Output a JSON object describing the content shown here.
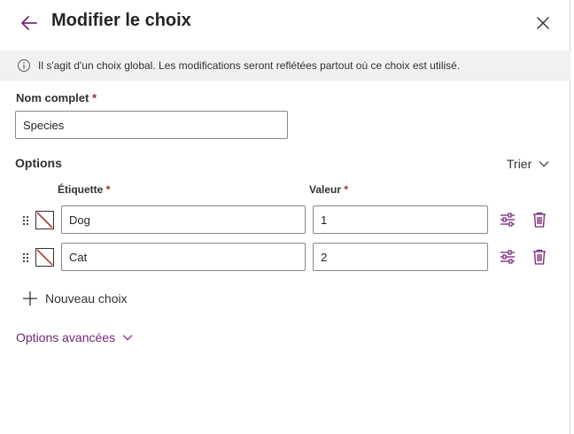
{
  "panel": {
    "title": "Modifier le choix"
  },
  "info": {
    "message": "Il s'agit d'un choix global. Les modifications seront reflétées partout où ce choix est utilisé."
  },
  "display_name": {
    "label": "Nom complet",
    "required_mark": "*",
    "value": "Species"
  },
  "options_section": {
    "title": "Options",
    "sort_label": "Trier",
    "label_header": "Étiquette",
    "value_header": "Valeur",
    "required_mark": "*",
    "rows": [
      {
        "label": "Dog",
        "value": "1"
      },
      {
        "label": "Cat",
        "value": "2"
      }
    ],
    "new_choice_label": "Nouveau choix"
  },
  "advanced": {
    "label": "Options avancées"
  },
  "colors": {
    "accent": "#742774",
    "swatch_slash": "#a4262c",
    "required": "#a4262c",
    "info_bg": "#f1f1f1"
  },
  "icons": [
    "back-arrow-icon",
    "close-icon",
    "info-icon",
    "drag-handle-icon",
    "no-color-swatch-icon",
    "settings-sliders-icon",
    "trash-icon",
    "plus-icon",
    "chevron-down-icon"
  ]
}
